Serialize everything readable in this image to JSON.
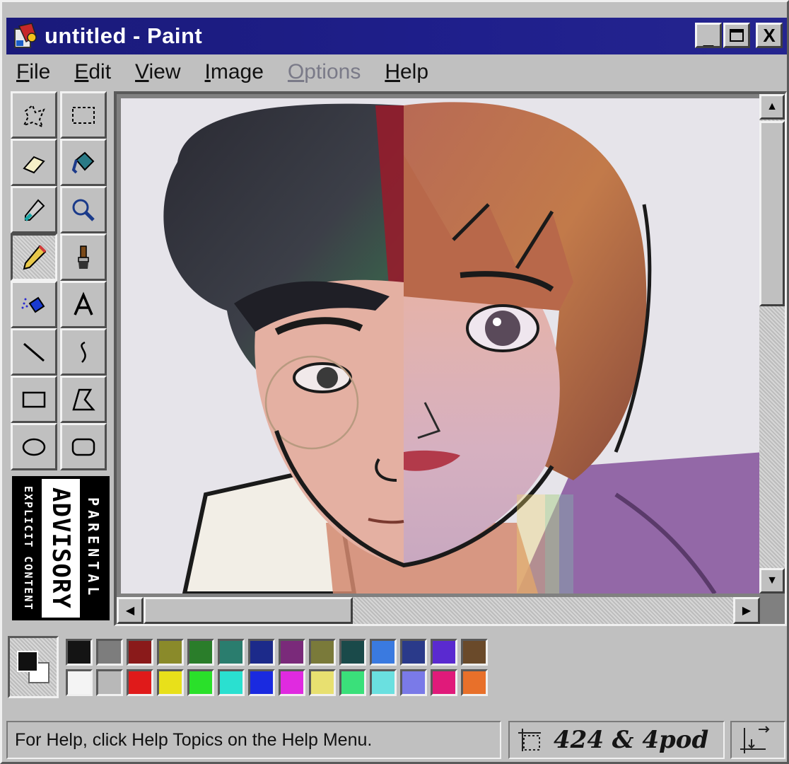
{
  "window": {
    "title": "untitled - Paint",
    "minimize_glyph": "_",
    "maximize_glyph": "□",
    "close_glyph": "X"
  },
  "menu": [
    {
      "label": "File",
      "accel": "F",
      "rest": "ile",
      "enabled": true
    },
    {
      "label": "Edit",
      "accel": "E",
      "rest": "dit",
      "enabled": true
    },
    {
      "label": "View",
      "accel": "V",
      "rest": "iew",
      "enabled": true
    },
    {
      "label": "Image",
      "accel": "I",
      "rest": "mage",
      "enabled": true
    },
    {
      "label": "Options",
      "accel": "O",
      "rest": "ptions",
      "enabled": false
    },
    {
      "label": "Help",
      "accel": "H",
      "rest": "elp",
      "enabled": true
    }
  ],
  "tools": [
    {
      "name": "free-form-select",
      "icon": "free-form-select-icon"
    },
    {
      "name": "rect-select",
      "icon": "rect-select-icon"
    },
    {
      "name": "eraser",
      "icon": "eraser-icon"
    },
    {
      "name": "fill",
      "icon": "paint-bucket-icon"
    },
    {
      "name": "pick-color",
      "icon": "eyedropper-icon"
    },
    {
      "name": "magnifier",
      "icon": "magnifier-icon"
    },
    {
      "name": "pencil",
      "icon": "pencil-icon",
      "active": true
    },
    {
      "name": "brush",
      "icon": "brush-icon"
    },
    {
      "name": "airbrush",
      "icon": "airbrush-icon"
    },
    {
      "name": "text",
      "icon": "text-icon"
    },
    {
      "name": "line",
      "icon": "line-icon"
    },
    {
      "name": "curve",
      "icon": "curve-icon"
    },
    {
      "name": "rectangle",
      "icon": "rectangle-icon"
    },
    {
      "name": "polygon",
      "icon": "polygon-icon"
    },
    {
      "name": "ellipse",
      "icon": "ellipse-icon"
    },
    {
      "name": "rounded-rectangle",
      "icon": "rounded-rectangle-icon"
    }
  ],
  "advisory": {
    "line1": "EXPLICIT CONTENT",
    "line2": "ADVISORY",
    "line3": "PARENTAL"
  },
  "palette": {
    "foreground": "#111111",
    "background": "#ffffff",
    "colors": [
      "#141414",
      "#7d7d7d",
      "#8a1a1a",
      "#8a8a2a",
      "#2a7d2a",
      "#2a7d6e",
      "#1c2a8a",
      "#7a2a7a",
      "#7a7a3a",
      "#1a4a4a",
      "#3a7ae0",
      "#2a3a8a",
      "#5a2ad0",
      "#6a4a2a",
      "#f4f4f4",
      "#b8b8b8",
      "#e01a1a",
      "#e8e01a",
      "#2ae02a",
      "#2ae0d0",
      "#1a2ae0",
      "#e02ae0",
      "#e8e070",
      "#3ae07a",
      "#6ae0e0",
      "#7a7ae8",
      "#e01a7a",
      "#e8702a"
    ]
  },
  "status": {
    "help_text": "For Help, click Help Topics on the Help Menu.",
    "coords_text": "424 & 4pod"
  },
  "scroll": {
    "up_glyph": "▲",
    "down_glyph": "▼",
    "left_glyph": "◀",
    "right_glyph": "▶"
  }
}
